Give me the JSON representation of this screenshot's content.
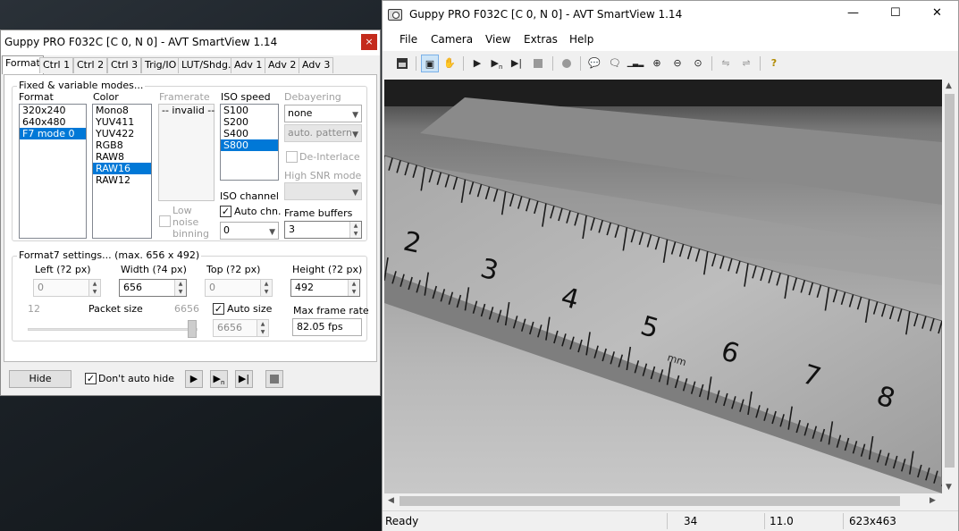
{
  "dialog": {
    "title": "Guppy PRO F032C [C 0, N 0] - AVT SmartView 1.14",
    "close_glyph": "×",
    "tabs": [
      "Format",
      "Ctrl 1",
      "Ctrl 2",
      "Ctrl 3",
      "Trig/IO",
      "LUT/Shdg.",
      "Adv 1",
      "Adv 2",
      "Adv 3"
    ],
    "active_tab": "Format",
    "fixed_group": "Fixed & variable modes...",
    "format_label": "Format",
    "format_items": [
      "320x240",
      "640x480",
      "F7 mode 0"
    ],
    "format_selected": "F7 mode 0",
    "color_label": "Color",
    "color_items": [
      "Mono8",
      "YUV411",
      "YUV422",
      "RGB8",
      "RAW8",
      "RAW16",
      "RAW12"
    ],
    "color_selected": "RAW16",
    "framerate_label": "Framerate",
    "framerate_items": [
      "-- invalid --"
    ],
    "iso_speed_label": "ISO speed",
    "iso_items": [
      "S100",
      "S200",
      "S400",
      "S800"
    ],
    "iso_selected": "S800",
    "debayering_label": "Debayering",
    "debayering_value": "none",
    "pattern_value": "auto. pattern",
    "deinterlace_label": "De-Interlace",
    "high_snr_label": "High SNR mode",
    "low_noise_label": "Low noise binning",
    "iso_channel_label": "ISO channel",
    "auto_chn_label": "Auto chn.",
    "iso_channel_value": "0",
    "frame_buffers_label": "Frame buffers",
    "frame_buffers_value": "3",
    "f7_group": "Format7 settings... (max. 656 x 492)",
    "left_label": "Left (?2 px)",
    "left_value": "0",
    "width_label": "Width (?4 px)",
    "width_value": "656",
    "top_label": "Top (?2 px)",
    "top_value": "0",
    "height_label": "Height (?2 px)",
    "height_value": "492",
    "packet_min": "12",
    "packet_label": "Packet size",
    "packet_max": "6656",
    "packet_value": "6656",
    "auto_size_label": "Auto size",
    "max_rate_label": "Max frame rate",
    "max_rate_value": "82.05 fps",
    "hide_label": "Hide",
    "dont_hide_label": "Don't auto hide"
  },
  "main": {
    "title": "Guppy PRO F032C [C 0, N 0] - AVT SmartView 1.14",
    "minimize": "—",
    "maximize": "☐",
    "close": "✕",
    "menu": [
      "File",
      "Camera",
      "View",
      "Extras",
      "Help"
    ],
    "toolbar_icons": [
      "save-icon",
      "camera-info-icon",
      "hand-icon",
      "play-icon",
      "play-n-icon",
      "play-step-icon",
      "stop-icon",
      "record-icon",
      "chat-icon",
      "chat-ok-icon",
      "histogram-icon",
      "zoom-in-icon",
      "zoom-out-icon",
      "zoom-fit-icon",
      "mirror-icon",
      "mirror-off-icon",
      "help-icon"
    ],
    "ruler_numbers": [
      "2",
      "3",
      "4",
      "5",
      "6",
      "7",
      "8"
    ],
    "ruler_unit": "mm",
    "status": {
      "ready": "Ready",
      "fps": "34",
      "value": "11.0",
      "size": "623x463"
    }
  },
  "colors": {
    "selection": "#0078d7",
    "close_red": "#c42b1c"
  }
}
